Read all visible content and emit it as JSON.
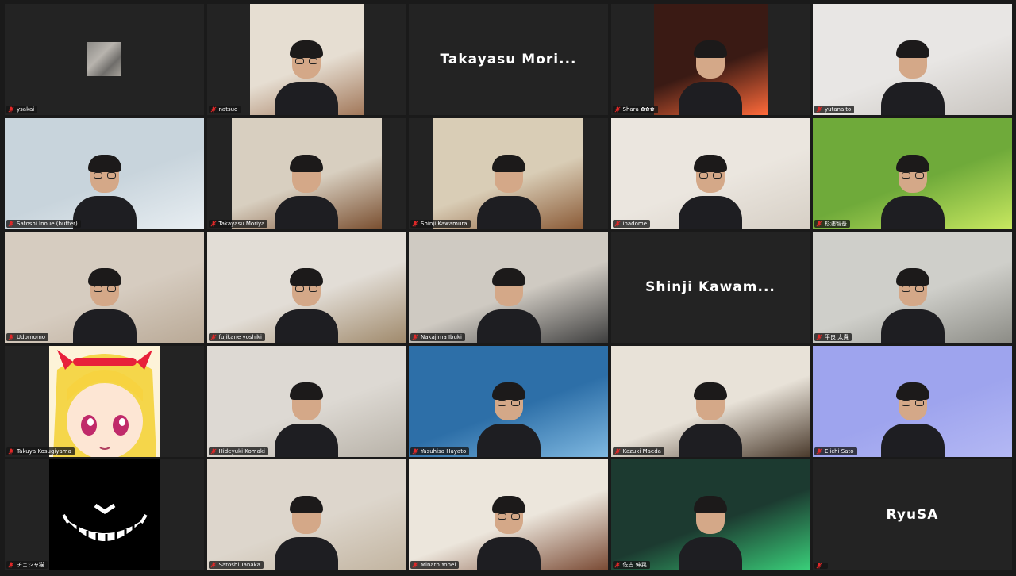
{
  "meeting": {
    "participants": [
      {
        "name": "ysakai",
        "type": "avatar"
      },
      {
        "name": "natsuo",
        "type": "video",
        "bg": "#e6ded2",
        "accent": "#a2785a"
      },
      {
        "name": "Takayasu Mori...",
        "type": "name-card"
      },
      {
        "name": "Shara ✿✿✿",
        "type": "video",
        "bg": "#3a1a14",
        "accent": "#ff6a3a"
      },
      {
        "name": "yutanaito",
        "type": "video",
        "bg": "#e8e6e4",
        "accent": "#c9c5c0"
      },
      {
        "name": "Satoshi Inoue (butter)",
        "type": "video",
        "bg": "#c8d4dc",
        "accent": "#e8eef2"
      },
      {
        "name": "Takayasu Moriya",
        "type": "video",
        "bg": "#d8cfc0",
        "accent": "#7a4f30"
      },
      {
        "name": "Shinji Kawamura",
        "type": "video",
        "bg": "#d9cdb6",
        "accent": "#8a5a36"
      },
      {
        "name": "inadome",
        "type": "video",
        "bg": "#ebe6df",
        "accent": "#d6cfc5"
      },
      {
        "name": "杉浦智基",
        "type": "video",
        "bg": "#6faa3a",
        "accent": "#c8e860"
      },
      {
        "name": "Udomomo",
        "type": "video",
        "bg": "#d6ccc0",
        "accent": "#b9a996"
      },
      {
        "name": "fujikane yoshiki",
        "type": "video",
        "bg": "#e2ddd6",
        "accent": "#a08a6c"
      },
      {
        "name": "Nakajima Ibuki",
        "type": "video",
        "bg": "#cfcac2",
        "accent": "#3e3e3e"
      },
      {
        "name": "Shinji Kawam...",
        "type": "name-card"
      },
      {
        "name": "平良 太貴",
        "type": "video",
        "bg": "#cfcfca",
        "accent": "#8c8c86"
      },
      {
        "name": "Takuya Kosugiyama",
        "type": "anime"
      },
      {
        "name": "Hideyuki Komaki",
        "type": "video",
        "bg": "#ddd9d3",
        "accent": "#b8b2a8"
      },
      {
        "name": "Yasuhisa Hayato",
        "type": "video",
        "bg": "#2d6fa8",
        "accent": "#7fb8e0"
      },
      {
        "name": "Kazuki Maeda",
        "type": "video",
        "bg": "#e8e2d8",
        "accent": "#4a3a2c"
      },
      {
        "name": "Eiichi Sato",
        "type": "video",
        "bg": "#9ea4ee",
        "accent": "#b4b8f4"
      },
      {
        "name": "チェシャ猫",
        "type": "cheshire"
      },
      {
        "name": "Satoshi Tanaka",
        "type": "video",
        "bg": "#ddd6cc",
        "accent": "#c2b4a0"
      },
      {
        "name": "Minato Yonei",
        "type": "video",
        "bg": "#ece6dc",
        "accent": "#7a4a34"
      },
      {
        "name": "佐古 伸晃",
        "type": "video",
        "bg": "#1c3a30",
        "accent": "#3ad07a"
      },
      {
        "name": "RyuSA",
        "type": "name-card",
        "hideLabel": true
      }
    ]
  },
  "colors": {
    "background": "#1a1a1a",
    "tile": "#232323",
    "mute": "#e02828"
  }
}
